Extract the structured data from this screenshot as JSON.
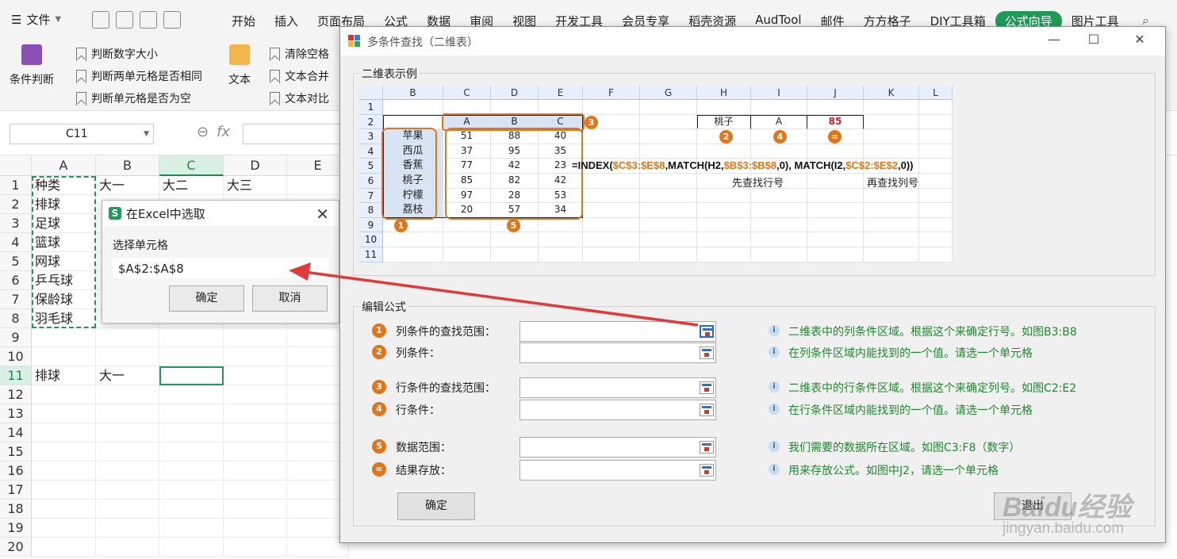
{
  "menu": {
    "file_label": "文件",
    "tabs": [
      "开始",
      "插入",
      "页面布局",
      "公式",
      "数据",
      "审阅",
      "视图",
      "开发工具",
      "会员专享",
      "稻壳资源",
      "AudTool",
      "邮件",
      "方方格子",
      "DIY工具箱",
      "公式向导",
      "图片工具"
    ],
    "active_tab": "公式向导"
  },
  "ribbon": {
    "group1_button": "条件判断",
    "group1_items": [
      "判断数字大小",
      "判断两单元格是否相同",
      "判断单元格是否为空"
    ],
    "group2_button": "文本",
    "group2_items": [
      "清除空格",
      "文本合并",
      "文本对比"
    ]
  },
  "formula_bar": {
    "name_box": "C11",
    "fx": "fx"
  },
  "sheet": {
    "columns": [
      "A",
      "B",
      "C",
      "D",
      "E"
    ],
    "rows": [
      "1",
      "2",
      "3",
      "4",
      "5",
      "6",
      "7",
      "8",
      "9",
      "10",
      "11",
      "12",
      "13",
      "14",
      "15",
      "16",
      "17",
      "18",
      "19",
      "20"
    ],
    "row1": [
      "种类",
      "大一",
      "大二",
      "大三"
    ],
    "col_a": [
      "排球",
      "足球",
      "篮球",
      "网球",
      "乒乓球",
      "保龄球",
      "羽毛球"
    ],
    "row11": [
      "排球",
      "大一"
    ],
    "selected_col": "C",
    "selected_row": "11"
  },
  "pick_dialog": {
    "title": "在Excel中选取",
    "logo": "S",
    "label": "选择单元格",
    "value": "$A$2:$A$8",
    "ok": "确定",
    "cancel": "取消"
  },
  "main_dialog": {
    "title": "多条件查找（二维表）",
    "example_group": "二维表示例",
    "edit_group": "编辑公式",
    "example": {
      "col_headers": [
        "B",
        "C",
        "D",
        "E",
        "F",
        "G",
        "H",
        "I",
        "J",
        "K",
        "L"
      ],
      "row_headers": [
        "1",
        "2",
        "3",
        "4",
        "5",
        "6",
        "7",
        "8",
        "9",
        "10",
        "11"
      ],
      "header_row": [
        "A",
        "B",
        "C"
      ],
      "fruits": [
        "苹果",
        "西瓜",
        "香蕉",
        "桃子",
        "柠檬",
        "荔枝"
      ],
      "values": [
        [
          51,
          88,
          40
        ],
        [
          37,
          95,
          35
        ],
        [
          77,
          42,
          23
        ],
        [
          85,
          82,
          42
        ],
        [
          97,
          28,
          53
        ],
        [
          20,
          57,
          34
        ]
      ],
      "lookup_row": [
        "桃子",
        "A",
        "85"
      ],
      "badges": [
        "1",
        "2",
        "3",
        "4",
        "5",
        "="
      ],
      "formula_parts": [
        {
          "t": "=INDEX(",
          "hl": false
        },
        {
          "t": "$C$3:$E$8",
          "hl": true
        },
        {
          "t": ",MATCH(H2,",
          "hl": false
        },
        {
          "t": "$B$3:$B$8",
          "hl": true
        },
        {
          "t": ",0), MATCH(I2,",
          "hl": false
        },
        {
          "t": "$C$2:$E$2",
          "hl": true
        },
        {
          "t": ",0))",
          "hl": false
        }
      ],
      "note_row": "先查找行号",
      "note_col": "再查找列号"
    },
    "fields": [
      {
        "badge": "1",
        "label": "列条件的查找范围：",
        "desc": "二维表中的列条件区域。根据这个来确定行号。如图B3:B8"
      },
      {
        "badge": "2",
        "label": "列条件：",
        "desc": "在列条件区域内能找到的一个值。请选一个单元格"
      },
      {
        "badge": "3",
        "label": "行条件的查找范围：",
        "desc": "二维表中的行条件区域。根据这个来确定列号。如图C2:E2"
      },
      {
        "badge": "4",
        "label": "行条件：",
        "desc": "在行条件区域内能找到的一个值。请选一个单元格"
      },
      {
        "badge": "5",
        "label": "数据范围：",
        "desc": "我们需要的数据所在区域。如图C3:F8（数字）"
      },
      {
        "badge": "=",
        "label": "结果存放：",
        "desc": "用来存放公式。如图中J2，请选一个单元格"
      }
    ],
    "ok": "确定",
    "exit": "退出"
  },
  "watermark": {
    "logo": "Baidu经验",
    "url": "jingyan.baidu.com"
  },
  "colors": {
    "accent_green": "#1f9a59",
    "orange": "#e0761b",
    "red_arrow": "#e03a3a",
    "desc_green": "#1e8a2e"
  }
}
